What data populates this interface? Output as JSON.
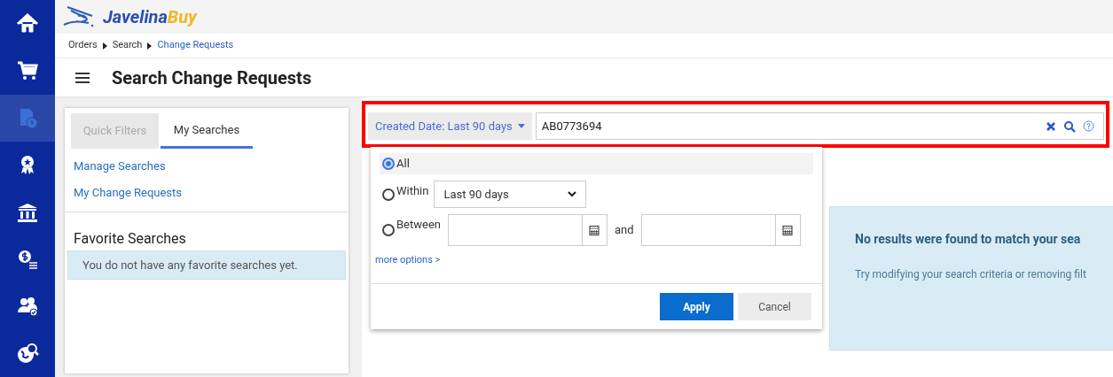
{
  "sidebar": {
    "items": [
      {
        "selected": false
      },
      {
        "selected": false
      },
      {
        "selected": true
      },
      {
        "selected": false
      },
      {
        "selected": false
      },
      {
        "selected": false
      },
      {
        "selected": false
      },
      {
        "selected": false
      }
    ]
  },
  "logo": {
    "part_1": "Javelina",
    "part_2": "Buy"
  },
  "breadcrumb": [
    {
      "label": "Orders",
      "current": false
    },
    {
      "label": "Search",
      "current": false
    },
    {
      "label": "Change Requests",
      "current": true
    }
  ],
  "page_title": "Search Change Requests",
  "left_panel": {
    "tabs": [
      {
        "label": "Quick Filters",
        "selected": false
      },
      {
        "label": "My Searches",
        "selected": true
      }
    ],
    "links": [
      "Manage Searches",
      "My Change Requests"
    ],
    "favorites_title": "Favorite Searches",
    "favorites_empty": "You do not have any favorite searches yet."
  },
  "search_bar": {
    "filter_button": "Created Date: Last 90 days",
    "query": "AB0773694"
  },
  "date_popover": {
    "options": [
      {
        "kind": "plain",
        "label": "All",
        "selected": true
      },
      {
        "kind": "select",
        "label": "Within",
        "value": "Last 90 days",
        "selected": false
      },
      {
        "kind": "range",
        "label": "Between",
        "joiner": "and",
        "selected": false
      }
    ],
    "more_link": "more options >",
    "buttons": [
      {
        "kind": "primary",
        "label": "Apply"
      },
      {
        "kind": "secondary",
        "label": "Cancel"
      }
    ]
  },
  "results": {
    "title": "No results were found to match your sea",
    "hint": "Try modifying your search criteria or removing filt"
  }
}
